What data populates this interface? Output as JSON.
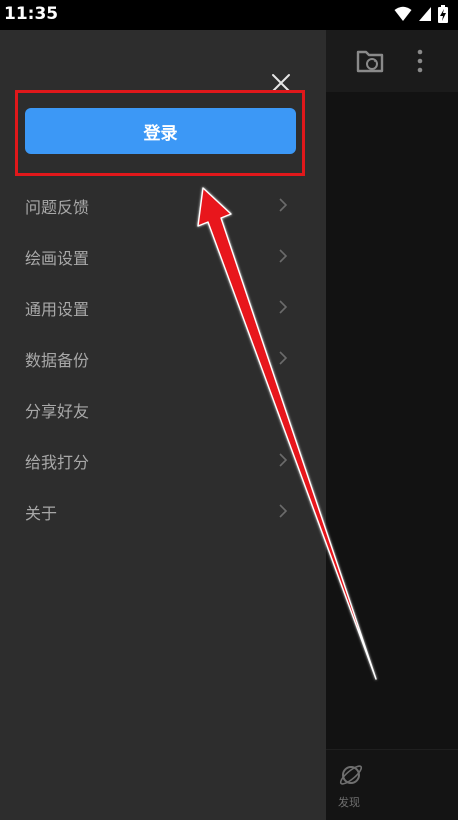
{
  "status_bar": {
    "time": "11:35",
    "icons": [
      "wifi-icon",
      "signal-icon",
      "battery-charging-icon"
    ]
  },
  "background_app": {
    "toolbar_icons": [
      "folder-sync-icon",
      "more-vertical-icon"
    ],
    "bottom_nav": {
      "icon": "planet-icon",
      "label": "发现"
    }
  },
  "drawer": {
    "close_icon": "close-icon",
    "login_label": "登录",
    "menu_items": [
      {
        "label": "问题反馈",
        "has_chevron": true
      },
      {
        "label": "绘画设置",
        "has_chevron": true
      },
      {
        "label": "通用设置",
        "has_chevron": true
      },
      {
        "label": "数据备份",
        "has_chevron": true
      },
      {
        "label": "分享好友",
        "has_chevron": false
      },
      {
        "label": "给我打分",
        "has_chevron": true
      },
      {
        "label": "关于",
        "has_chevron": true
      }
    ]
  },
  "colors": {
    "drawer_bg": "#2d2d2d",
    "app_bg": "#121212",
    "login_button": "#3c98f6",
    "highlight_border": "#e0181b",
    "menu_text": "#a8a8a8",
    "chevron": "#6b6b6b"
  }
}
